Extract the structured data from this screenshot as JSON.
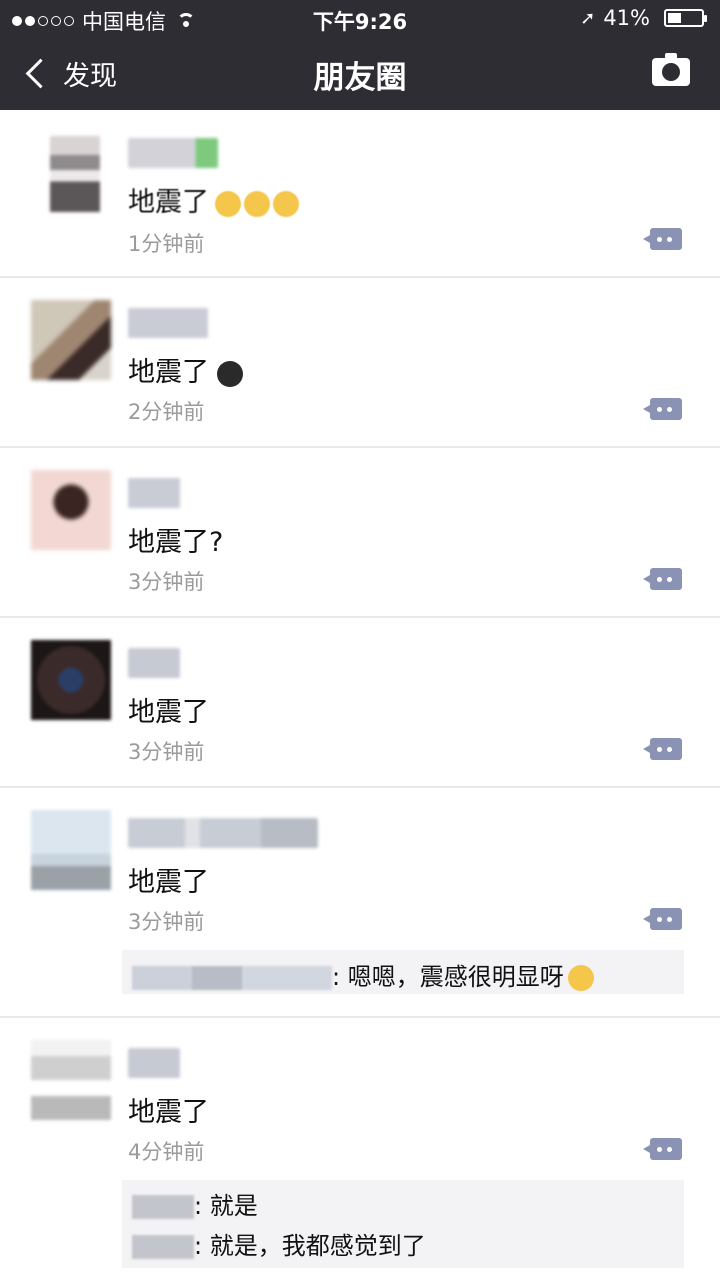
{
  "status_bar": {
    "carrier": "中国电信",
    "time": "下午9:26",
    "battery_percent": "41%",
    "battery_level": 0.41
  },
  "nav": {
    "back_label": "发现",
    "title": "朋友圈"
  },
  "posts": [
    {
      "content": "地震了",
      "timestamp": "1分钟前",
      "emoji_count": 3
    },
    {
      "content": "地震了",
      "timestamp": "2分钟前",
      "emoji_count": 1
    },
    {
      "content": "地震了?",
      "timestamp": "3分钟前",
      "emoji_count": 0
    },
    {
      "content": "地震了",
      "timestamp": "3分钟前",
      "emoji_count": 0
    },
    {
      "content": "地震了",
      "timestamp": "3分钟前",
      "emoji_count": 0,
      "replies": [
        {
          "text": ": 嗯嗯，震感很明显呀"
        }
      ]
    },
    {
      "content": "地震了",
      "timestamp": "4分钟前",
      "emoji_count": 0,
      "replies": [
        {
          "text": ": 就是"
        },
        {
          "text": ": 就是，我都感觉到了"
        }
      ]
    }
  ],
  "icons": {
    "back": "chevron-left-icon",
    "camera": "camera-icon",
    "comment": "comment-dots-icon",
    "location": "location-arrow-icon"
  },
  "colors": {
    "nav_background": "#2e2d33",
    "timestamp": "#9a9a9a",
    "comment_button": "#8a93b4",
    "reply_background": "#f3f3f5"
  }
}
